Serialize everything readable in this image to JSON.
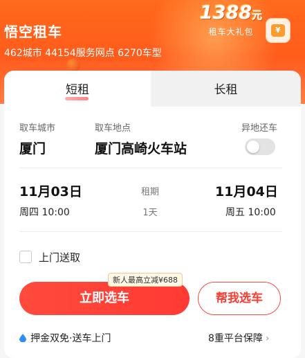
{
  "header": {
    "app_title": "悟空租车",
    "subtitle": "462城市 44154服务网点 6270车型",
    "promo_amount": "1388",
    "promo_unit": "元",
    "promo_caption": "租车大礼包",
    "gift_symbol": "¥"
  },
  "tabs": [
    {
      "label": "短租",
      "active": true
    },
    {
      "label": "长租",
      "active": false
    }
  ],
  "location": {
    "city_label": "取车城市",
    "city_value": "厦门",
    "place_label": "取车地点",
    "place_value": "厦门高崎火车站",
    "return_label": "异地还车",
    "return_toggle_on": false
  },
  "dates": {
    "pickup_date": "11月03日",
    "pickup_time": "周四 10:00",
    "duration_label": "租期",
    "duration_value": "1天",
    "return_date": "11月04日",
    "return_time": "周五 10:00"
  },
  "options": {
    "door_pickup_label": "上门送取",
    "door_pickup_checked": false
  },
  "actions": {
    "primary_label": "立即选车",
    "promo_bubble": "新人最高立减¥688",
    "secondary_label": "帮我选车"
  },
  "footer": {
    "left_text": "押金双免·送车上门",
    "right_text": "8重平台保障",
    "right_chevron": "›"
  },
  "colors": {
    "brand_orange": "#ff5b1b",
    "primary_red": "#ff3a34"
  }
}
